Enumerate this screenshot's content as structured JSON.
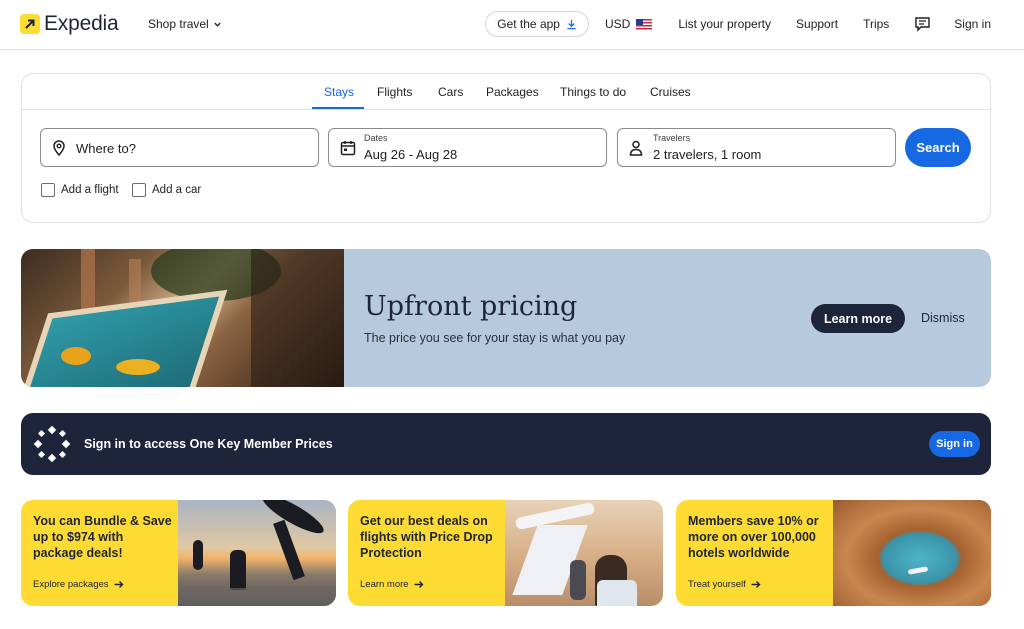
{
  "header": {
    "logo_text": "Expedia",
    "shop_travel": "Shop travel",
    "get_app": "Get the app",
    "currency": "USD",
    "list_property": "List your property",
    "support": "Support",
    "trips": "Trips",
    "sign_in": "Sign in",
    "brand_yellow": "#fddb32",
    "brand_navy": "#1e243a"
  },
  "search": {
    "tabs": [
      {
        "label": "Stays",
        "active": true
      },
      {
        "label": "Flights"
      },
      {
        "label": "Cars"
      },
      {
        "label": "Packages"
      },
      {
        "label": "Things to do"
      },
      {
        "label": "Cruises"
      }
    ],
    "destination_placeholder": "Where to?",
    "dates_label": "Dates",
    "dates_value": "Aug 26 - Aug 28",
    "travelers_label": "Travelers",
    "travelers_value": "2 travelers, 1 room",
    "search_button": "Search",
    "add_flight": "Add a flight",
    "add_car": "Add a car",
    "accent": "#1668e3"
  },
  "promo": {
    "title": "Upfront pricing",
    "subtitle": "The price you see for your stay is what you pay",
    "learn_more": "Learn more",
    "dismiss": "Dismiss"
  },
  "onekey": {
    "text": "Sign in to access One Key Member Prices",
    "button": "Sign in"
  },
  "deals": [
    {
      "text": "You can Bundle & Save up to $974 with package deals!",
      "link": "Explore packages"
    },
    {
      "text": "Get our best deals on flights with Price Drop Protection",
      "link": "Learn more"
    },
    {
      "text": "Members save 10% or more on over 100,000 hotels worldwide",
      "link": "Treat yourself"
    }
  ]
}
